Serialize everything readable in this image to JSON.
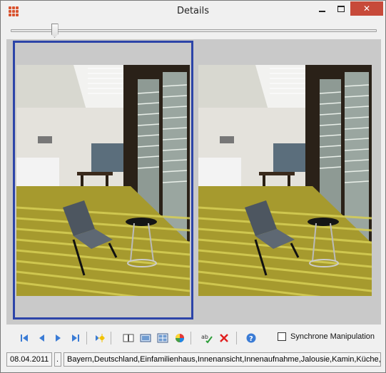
{
  "window": {
    "title": "Details",
    "close_glyph": "✕"
  },
  "slider": {
    "value_fraction": 0.12
  },
  "sync": {
    "label": "Synchrone Manipulation",
    "checked": false
  },
  "status": {
    "date": "08.04.2011",
    "separator": ".",
    "tags": "Bayern,Deutschland,Einfamilienhaus,Innenansicht,Innenaufnahme,Jalousie,Kamin,Küche,I"
  },
  "toolbar": {
    "icons": [
      "first-icon",
      "previous-icon",
      "next-icon",
      "last-icon",
      "new-icon",
      "book-icon",
      "single-view-icon",
      "grid-view-icon",
      "color-wheel-icon",
      "spellcheck-icon",
      "delete-icon",
      "help-icon"
    ]
  },
  "colors": {
    "accent": "#2c44a8",
    "close": "#c74a3a"
  }
}
